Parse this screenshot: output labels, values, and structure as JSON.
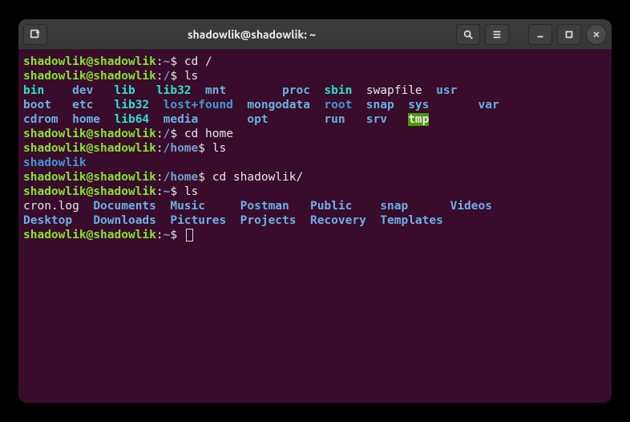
{
  "window": {
    "title": "shadowlik@shadowlik: ~"
  },
  "session": {
    "userhost": "shadowlik@shadowlik",
    "prompts": [
      {
        "path": "~",
        "cmd": "cd /"
      },
      {
        "path": "/",
        "cmd": "ls"
      },
      {
        "path": "/",
        "cmd": "cd home"
      },
      {
        "path": "/home",
        "cmd": "ls"
      },
      {
        "path": "/home",
        "cmd": "cd shadowlik/"
      },
      {
        "path": "~",
        "cmd": "ls"
      },
      {
        "path": "~",
        "cmd": ""
      }
    ],
    "ls_root": [
      [
        {
          "n": "bin",
          "c": "sym",
          "w": 7
        },
        {
          "n": "dev",
          "c": "dirlt",
          "w": 6
        },
        {
          "n": "lib",
          "c": "sym",
          "w": 6
        },
        {
          "n": "lib32",
          "c": "sym",
          "w": 7
        },
        {
          "n": "mnt",
          "c": "dirlt",
          "w": 11
        },
        {
          "n": "proc",
          "c": "dirlt",
          "w": 6
        },
        {
          "n": "sbin",
          "c": "sym",
          "w": 6
        },
        {
          "n": "swapfile",
          "c": "file",
          "w": 10
        },
        {
          "n": "usr",
          "c": "dirlt",
          "w": 3
        }
      ],
      [
        {
          "n": "boot",
          "c": "dirlt",
          "w": 7
        },
        {
          "n": "etc",
          "c": "dirlt",
          "w": 6
        },
        {
          "n": "lib32",
          "c": "sym",
          "w": 7
        },
        {
          "n": "lost+found",
          "c": "dir",
          "w": 12
        },
        {
          "n": "mongodata",
          "c": "dirlt",
          "w": 11
        },
        {
          "n": "root",
          "c": "dir",
          "w": 6
        },
        {
          "n": "snap",
          "c": "dirlt",
          "w": 6
        },
        {
          "n": "sys",
          "c": "dirlt",
          "w": 10
        },
        {
          "n": "var",
          "c": "dirlt",
          "w": 3
        }
      ],
      [
        {
          "n": "cdrom",
          "c": "dirlt",
          "w": 7
        },
        {
          "n": "home",
          "c": "dirlt",
          "w": 6
        },
        {
          "n": "lib64",
          "c": "sym",
          "w": 7
        },
        {
          "n": "media",
          "c": "dirlt",
          "w": 12
        },
        {
          "n": "opt",
          "c": "dirlt",
          "w": 11
        },
        {
          "n": "run",
          "c": "dirlt",
          "w": 6
        },
        {
          "n": "srv",
          "c": "dirlt",
          "w": 6
        },
        {
          "n": "tmp",
          "c": "sticky",
          "w": 3
        }
      ]
    ],
    "ls_home": [
      [
        {
          "n": "shadowlik",
          "c": "dir",
          "w": 9
        }
      ]
    ],
    "ls_user": [
      [
        {
          "n": "cron.log",
          "c": "file",
          "w": 10
        },
        {
          "n": "Documents",
          "c": "dirlt",
          "w": 11
        },
        {
          "n": "Music",
          "c": "dirlt",
          "w": 10
        },
        {
          "n": "Postman",
          "c": "dirlt",
          "w": 10
        },
        {
          "n": "Public",
          "c": "dirlt",
          "w": 10
        },
        {
          "n": "snap",
          "c": "dirlt",
          "w": 10
        },
        {
          "n": "Videos",
          "c": "dirlt",
          "w": 6
        }
      ],
      [
        {
          "n": "Desktop",
          "c": "dirlt",
          "w": 10
        },
        {
          "n": "Downloads",
          "c": "dirlt",
          "w": 11
        },
        {
          "n": "Pictures",
          "c": "dirlt",
          "w": 10
        },
        {
          "n": "Projects",
          "c": "dirlt",
          "w": 10
        },
        {
          "n": "Recovery",
          "c": "dirlt",
          "w": 10
        },
        {
          "n": "Templates",
          "c": "dirlt",
          "w": 10
        }
      ]
    ]
  }
}
